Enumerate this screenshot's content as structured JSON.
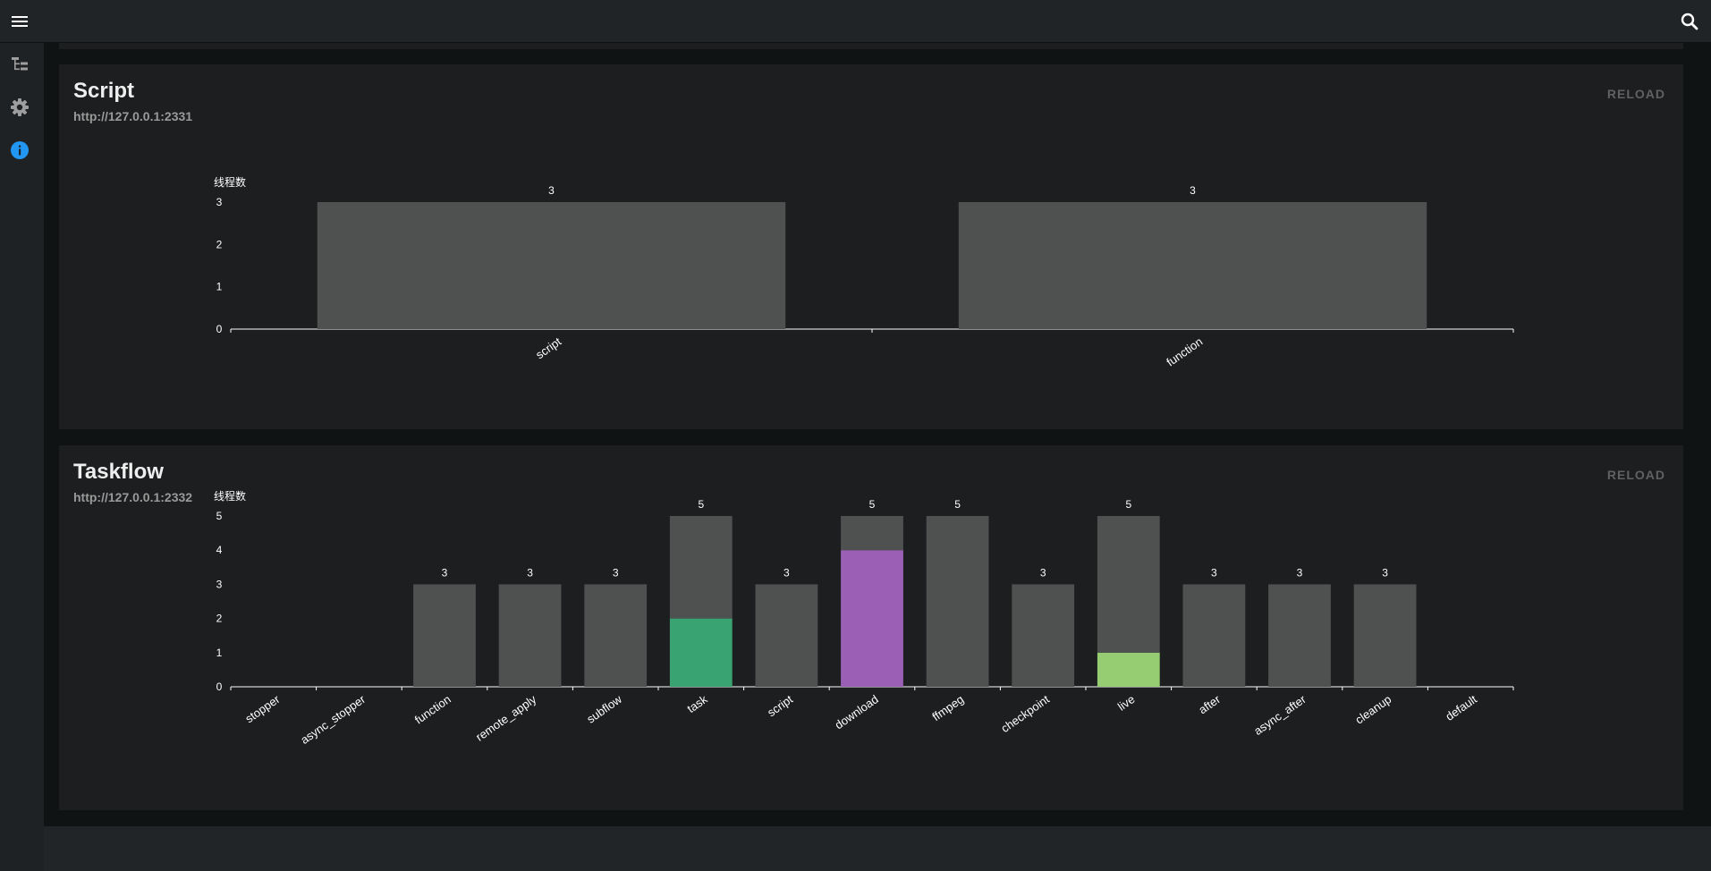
{
  "cards": [
    {
      "title": "Script",
      "url": "http://127.0.0.1:2331",
      "reload_label": "RELOAD",
      "chart_data": {
        "type": "bar",
        "ylabel": "线程数",
        "categories": [
          "script",
          "function"
        ],
        "ylim": [
          0,
          3
        ],
        "yticks": [
          0,
          1,
          2,
          3
        ],
        "totals": [
          3,
          3
        ],
        "series": [
          {
            "color": "#4f5150",
            "values": [
              3,
              3
            ]
          }
        ]
      }
    },
    {
      "title": "Taskflow",
      "url": "http://127.0.0.1:2332",
      "reload_label": "RELOAD",
      "chart_data": {
        "type": "bar",
        "stacked": true,
        "ylabel": "线程数",
        "categories": [
          "stopper",
          "async_stopper",
          "function",
          "remote_apply",
          "subflow",
          "task",
          "script",
          "download",
          "ffmpeg",
          "checkpoint",
          "live",
          "after",
          "async_after",
          "cleanup",
          "default"
        ],
        "ylim": [
          0,
          5
        ],
        "yticks": [
          0,
          1,
          2,
          3,
          4,
          5
        ],
        "totals": [
          0,
          0,
          3,
          3,
          3,
          5,
          3,
          5,
          5,
          3,
          5,
          3,
          3,
          3,
          0
        ],
        "series": [
          {
            "color": "#3aa372",
            "values": [
              0,
              0,
              0,
              0,
              0,
              2,
              0,
              0,
              0,
              0,
              0,
              0,
              0,
              0,
              0
            ]
          },
          {
            "color": "#9b5fb5",
            "values": [
              0,
              0,
              0,
              0,
              0,
              0,
              0,
              4,
              0,
              0,
              0,
              0,
              0,
              0,
              0
            ]
          },
          {
            "color": "#96cc72",
            "values": [
              0,
              0,
              0,
              0,
              0,
              0,
              0,
              0,
              0,
              0,
              1,
              0,
              0,
              0,
              0
            ]
          },
          {
            "color": "#4f5150",
            "values": [
              0,
              0,
              3,
              3,
              3,
              3,
              3,
              1,
              5,
              3,
              4,
              3,
              3,
              3,
              0
            ]
          }
        ]
      }
    }
  ],
  "icons": {
    "menu": "menu-icon",
    "search": "search-icon",
    "tree": "tree-icon",
    "settings": "gear-icon",
    "info": "info-icon"
  },
  "colors": {
    "accent": "#2196f3",
    "bar_default": "#4f5150"
  }
}
